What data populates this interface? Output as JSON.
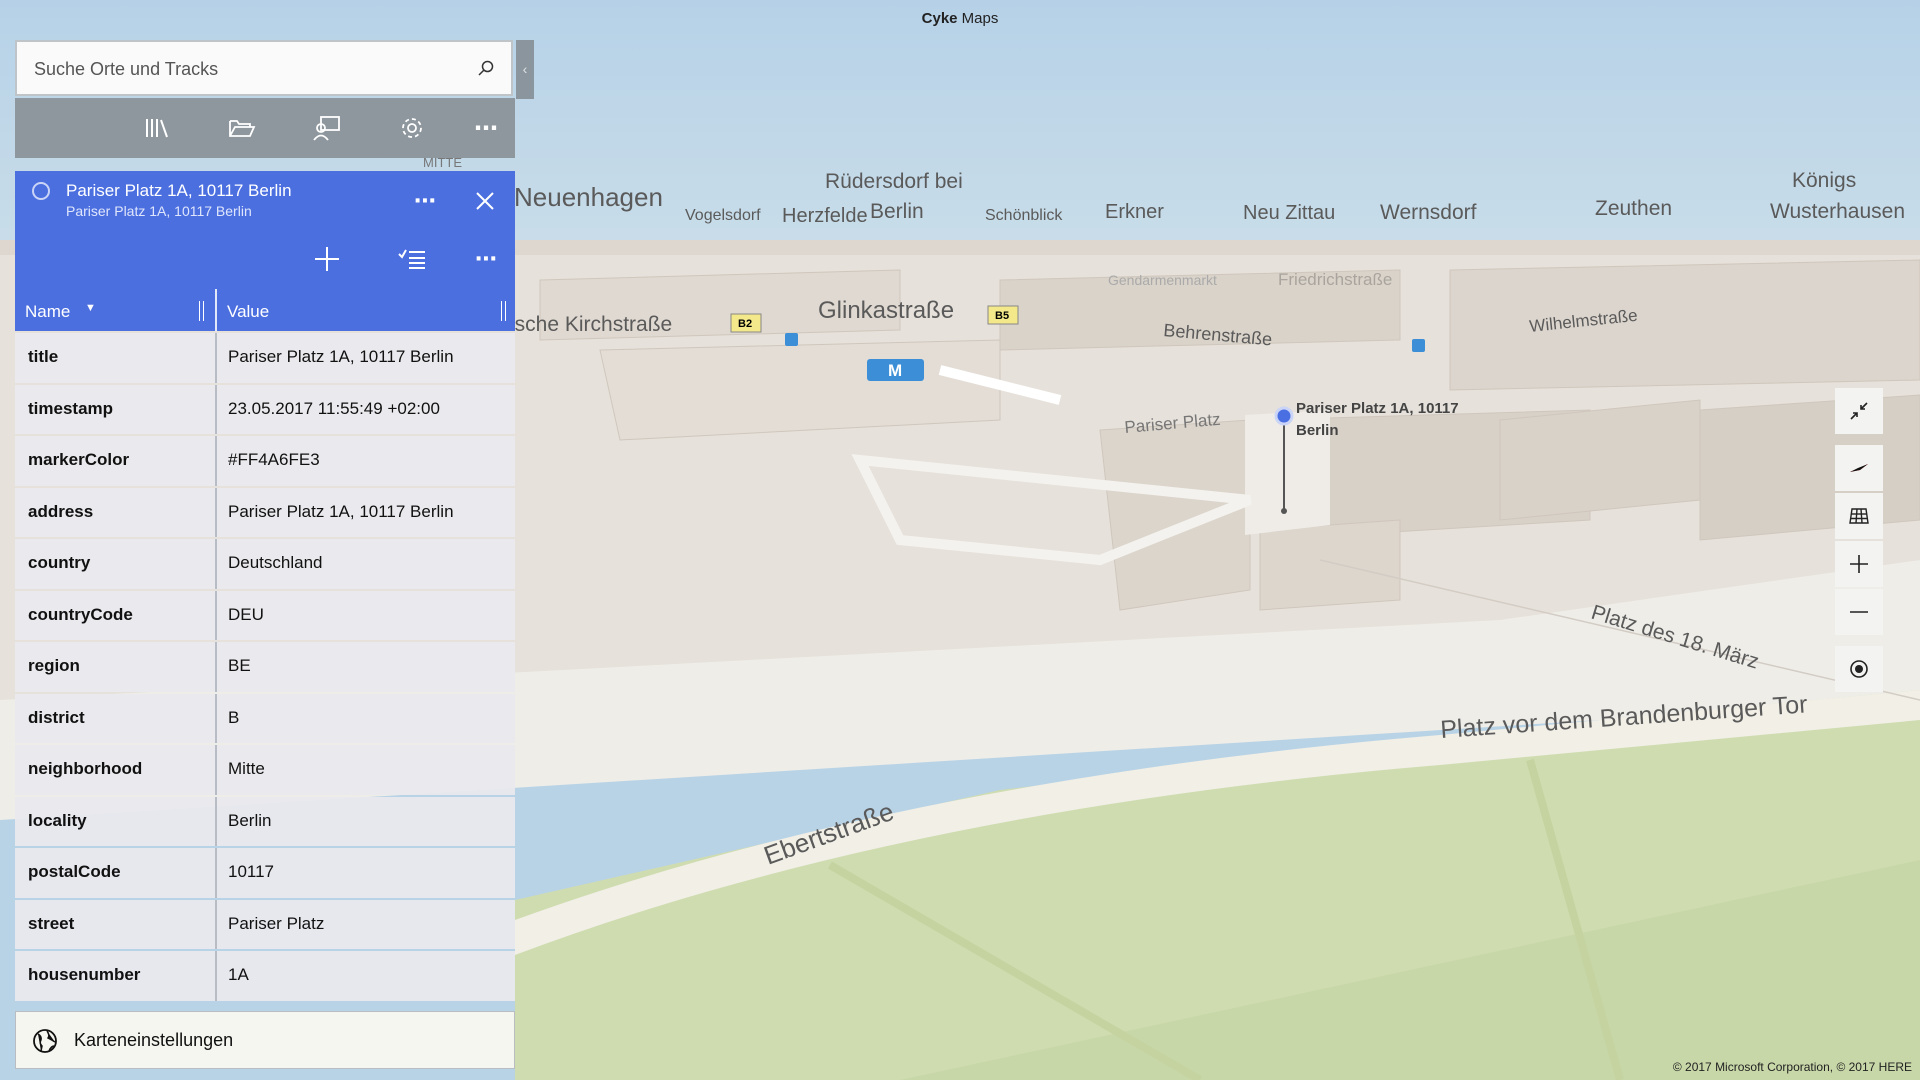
{
  "app": {
    "title_bold": "Cyke",
    "title_rest": " Maps"
  },
  "search": {
    "placeholder": "Suche Orte und Tracks"
  },
  "detail": {
    "title": "Pariser Platz 1A, 10117 Berlin",
    "subtitle": "Pariser Platz 1A, 10117 Berlin",
    "columns": {
      "name": "Name",
      "value": "Value"
    },
    "rows": [
      {
        "key": "title",
        "value": "Pariser Platz 1A, 10117 Berlin"
      },
      {
        "key": "timestamp",
        "value": "23.05.2017 11:55:49 +02:00"
      },
      {
        "key": "markerColor",
        "value": "#FF4A6FE3"
      },
      {
        "key": "address",
        "value": "Pariser Platz 1A, 10117 Berlin"
      },
      {
        "key": "country",
        "value": "Deutschland"
      },
      {
        "key": "countryCode",
        "value": "DEU"
      },
      {
        "key": "region",
        "value": "BE"
      },
      {
        "key": "district",
        "value": "B"
      },
      {
        "key": "neighborhood",
        "value": "Mitte"
      },
      {
        "key": "locality",
        "value": "Berlin"
      },
      {
        "key": "postalCode",
        "value": "10117"
      },
      {
        "key": "street",
        "value": "Pariser Platz"
      },
      {
        "key": "housenumber",
        "value": "1A"
      }
    ]
  },
  "map_settings_label": "Karteneinstellungen",
  "map": {
    "labels": {
      "neuenhagen": "Neuenhagen",
      "vogelsdorf": "Vogelsdorf",
      "ruedersdorf_1": "Rüdersdorf bei",
      "ruedersdorf_2": "Berlin",
      "herzfelde": "Herzfelde",
      "schoenblick": "Schönblick",
      "erkner": "Erkner",
      "neu_zittau": "Neu Zittau",
      "wernsdorf": "Wernsdorf",
      "zeuthen": "Zeuthen",
      "koenigs_1": "Königs",
      "koenigs_2": "Wusterhausen",
      "mitte": "MITTE",
      "kirchstrasse": "ische Kirchstraße",
      "glinkastrasse": "Glinkastraße",
      "gendarmenmarkt": "Gendarmenmarkt",
      "friedrichstrasse": "Friedrichstraße",
      "behrenstrasse": "Behrenstraße",
      "wilhelmstrasse": "Wilhelmstraße",
      "pariser_platz": "Pariser Platz",
      "platz_18_maerz": "Platz des 18. März",
      "platz_vor_tor": "Platz vor dem Brandenburger Tor",
      "ebertstrasse": "Ebertstraße",
      "b2": "B2",
      "b5": "B5",
      "transit": "M"
    },
    "pin_label_1": "Pariser Platz 1A, 10117",
    "pin_label_2": "Berlin",
    "pin_color": "#4a6fe3",
    "copyright": "© 2017 Microsoft Corporation, © 2017 HERE"
  },
  "colors": {
    "accent": "#4c6fe0",
    "toolbar": "#8e979e"
  },
  "icons": {
    "toolbar": [
      "library-icon",
      "folder-open-icon",
      "share-location-icon",
      "settings-icon",
      "more-icon"
    ],
    "detail": [
      "more-icon",
      "close-icon",
      "add-icon",
      "list-icon",
      "more-icon"
    ],
    "controls": [
      "exit-fullscreen-icon",
      "compass-icon",
      "map-style-icon",
      "zoom-in-icon",
      "zoom-out-icon",
      "my-location-icon"
    ]
  }
}
